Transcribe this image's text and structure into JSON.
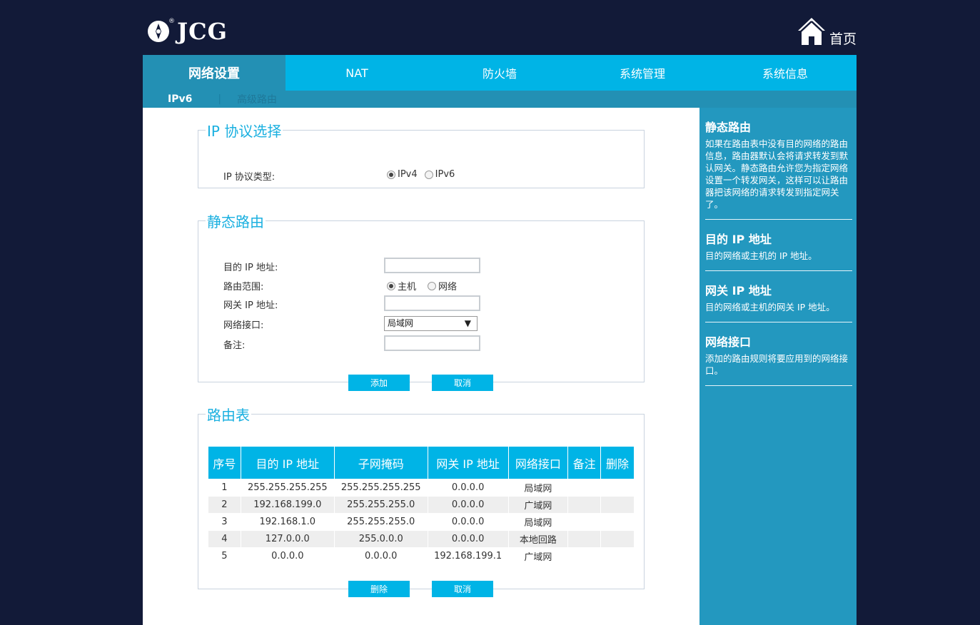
{
  "brand": {
    "logo_text": "JCG",
    "reg_mark": "®"
  },
  "home_label": "首页",
  "main_nav": [
    {
      "label": "网络设置",
      "active": true
    },
    {
      "label": "NAT",
      "active": false
    },
    {
      "label": "防火墙",
      "active": false
    },
    {
      "label": "系统管理",
      "active": false
    },
    {
      "label": "系统信息",
      "active": false
    }
  ],
  "sub_nav": {
    "ipv6": "IPv6",
    "separator": "|",
    "advanced_routing": "高级路由"
  },
  "ip_protocol": {
    "legend": "IP 协议选择",
    "type_label": "IP 协议类型:",
    "options": [
      "IPv4",
      "IPv6"
    ],
    "selected": "IPv4"
  },
  "static_route": {
    "legend": "静态路由",
    "dest_ip_label": "目的 IP 地址:",
    "dest_ip_value": "",
    "scope_label": "路由范围:",
    "scope_options": [
      "主机",
      "网络"
    ],
    "scope_selected": "主机",
    "gateway_label": "网关 IP 地址:",
    "gateway_value": "",
    "interface_label": "网络接口:",
    "interface_selected": "局域网",
    "note_label": "备注:",
    "note_value": "",
    "add_button": "添加",
    "cancel_button": "取消"
  },
  "route_table": {
    "legend": "路由表",
    "columns": [
      "序号",
      "目的 IP 地址",
      "子网掩码",
      "网关 IP 地址",
      "网络接口",
      "备注",
      "删除"
    ],
    "rows": [
      [
        "1",
        "255.255.255.255",
        "255.255.255.255",
        "0.0.0.0",
        "局域网",
        "",
        ""
      ],
      [
        "2",
        "192.168.199.0",
        "255.255.255.0",
        "0.0.0.0",
        "广域网",
        "",
        ""
      ],
      [
        "3",
        "192.168.1.0",
        "255.255.255.0",
        "0.0.0.0",
        "局域网",
        "",
        ""
      ],
      [
        "4",
        "127.0.0.0",
        "255.0.0.0",
        "0.0.0.0",
        "本地回路",
        "",
        ""
      ],
      [
        "5",
        "0.0.0.0",
        "0.0.0.0",
        "192.168.199.1",
        "广域网",
        "",
        ""
      ]
    ],
    "delete_button": "删除",
    "cancel_button": "取消"
  },
  "help": [
    {
      "title": "静态路由",
      "text": "如果在路由表中没有目的网络的路由信息，路由器默认会将请求转发到默认网关。静态路由允许您为指定网络设置一个转发网关，这样可以让路由器把该网络的请求转发到指定网关了。"
    },
    {
      "title": "目的 IP 地址",
      "text": "目的网络或主机的 IP 地址。"
    },
    {
      "title": "网关 IP 地址",
      "text": "目的网络或主机的网关 IP 地址。"
    },
    {
      "title": "网络接口",
      "text": "添加的路由规则将要应用到的网络接口。"
    }
  ],
  "colors": {
    "page_bg": "#121a38",
    "accent": "#00b4e6",
    "accent_dark": "#2390b4",
    "sidebar": "#2398bf"
  }
}
